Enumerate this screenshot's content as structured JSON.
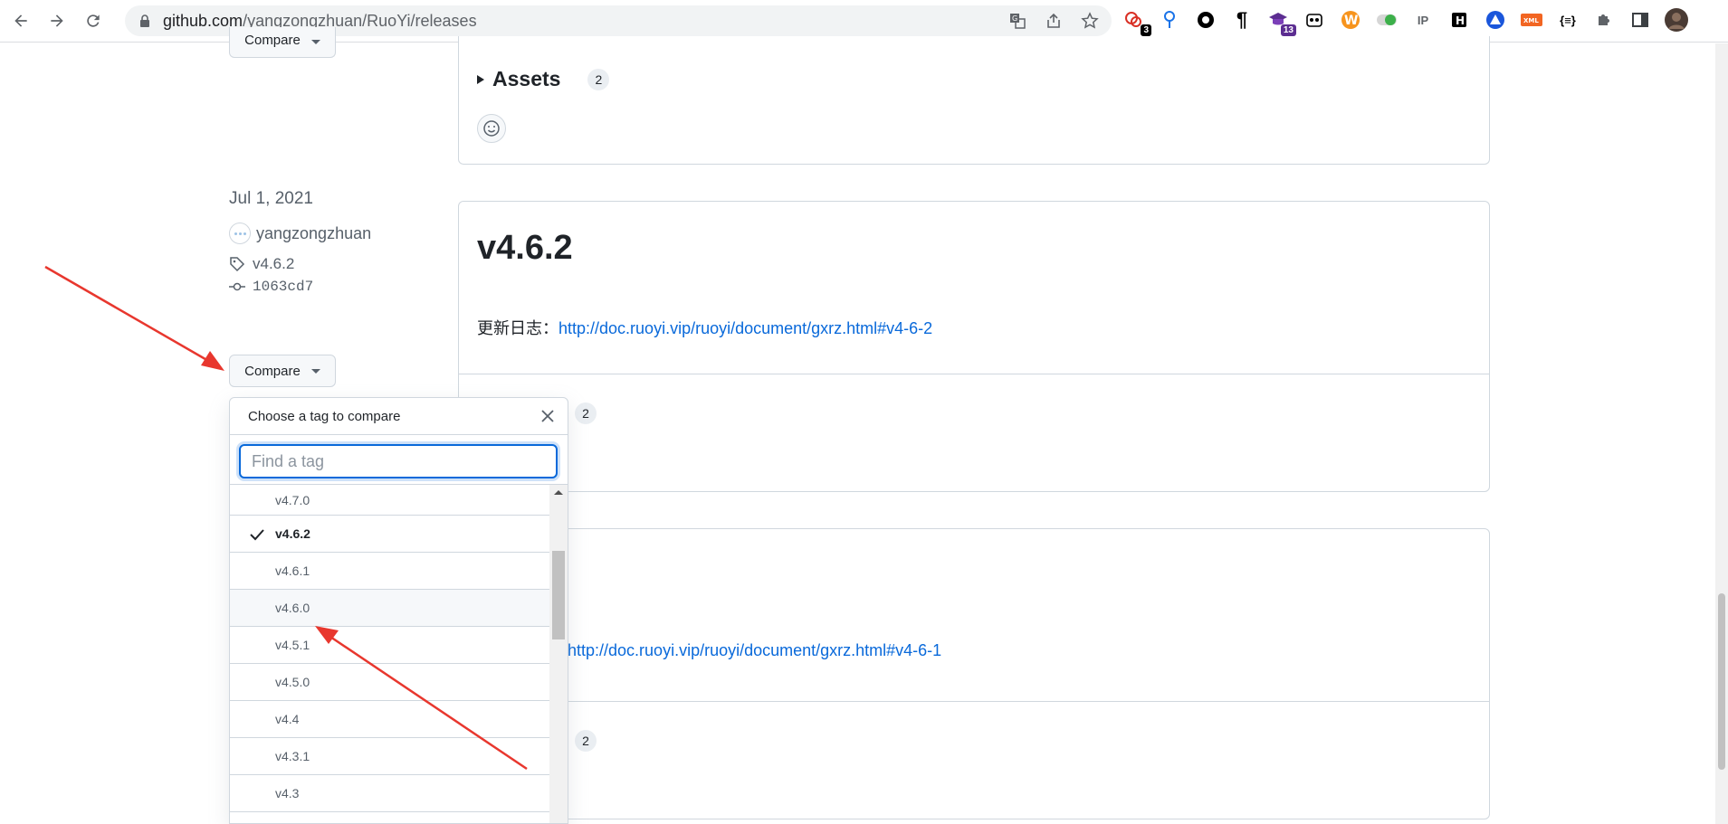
{
  "browser": {
    "url_host": "github.com",
    "url_path": "/yangzongzhuan/RuoYi/releases",
    "extension_badges": {
      "ext1": "3",
      "ext5": "13"
    }
  },
  "releases": {
    "prev_compare_label": "Compare",
    "assets_label": "Assets",
    "assets_count": "2",
    "second": {
      "date": "Jul 1, 2021",
      "author": "yangzongzhuan",
      "tag": "v4.6.2",
      "commit": "1063cd7",
      "compare_label": "Compare",
      "title": "v4.6.2",
      "changelog_prefix": "更新日志：",
      "changelog_link": "http://doc.ruoyi.vip/ruoyi/document/gxrz.html#v4-6-2",
      "assets_count": "2"
    },
    "third": {
      "changelog_link": "http://doc.ruoyi.vip/ruoyi/document/gxrz.html#v4-6-1",
      "assets_count": "2"
    }
  },
  "dropdown": {
    "title": "Choose a tag to compare",
    "placeholder": "Find a tag",
    "tags": [
      "v4.7.0",
      "v4.6.2",
      "v4.6.1",
      "v4.6.0",
      "v4.5.1",
      "v4.5.0",
      "v4.4",
      "v4.3.1",
      "v4.3"
    ],
    "selected": "v4.6.2",
    "hovered": "v4.6.0"
  },
  "colors": {
    "link": "#0969da",
    "border": "#d0d7de",
    "annotation_arrow": "#e8372e"
  }
}
